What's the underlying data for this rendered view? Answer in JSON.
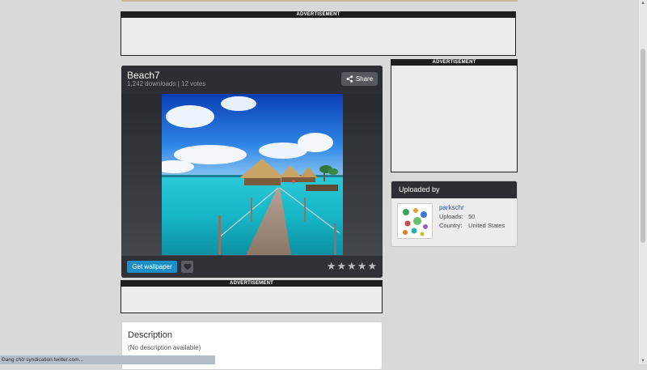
{
  "ads": {
    "label": "ADVERTISEMENT"
  },
  "wallpaper": {
    "title": "Beach7",
    "stats": "1,242 downloads | 12 votes",
    "share_label": "Share",
    "get_label": "Get wallpaper",
    "rating_stars": 5
  },
  "uploader": {
    "heading": "Uploaded by",
    "name": "parkschr",
    "uploads_label": "Uploads:",
    "uploads_value": "50",
    "country_label": "Country:",
    "country_value": "United States"
  },
  "description": {
    "title": "Description",
    "text": "(No description available)"
  },
  "status_bar": {
    "text": "Đang chờ syndication.twitter.com..."
  },
  "colors": {
    "accent_button": "#1e8fc6",
    "card_dark": "#2f3136",
    "link": "#2a55b0",
    "page_bg": "#d9d9d9"
  },
  "icons": [
    "share-icon",
    "heart-icon",
    "star-icon"
  ]
}
